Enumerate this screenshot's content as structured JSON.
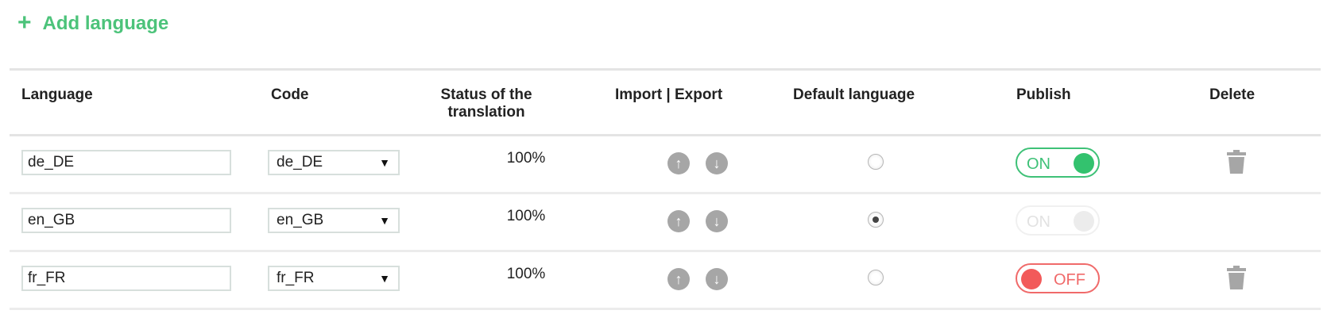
{
  "add_language": {
    "label": "Add language",
    "icon": "plus-icon"
  },
  "columns": {
    "language": "Language",
    "code": "Code",
    "status_line1": "Status of the",
    "status_line2": "translation",
    "import_export": "Import | Export",
    "default_language": "Default language",
    "publish": "Publish",
    "delete": "Delete"
  },
  "rows": [
    {
      "language": "de_DE",
      "code": "de_DE",
      "status": "100%",
      "default": false,
      "publish": {
        "label": "ON",
        "state": "on"
      },
      "deletable": true
    },
    {
      "language": "en_GB",
      "code": "en_GB",
      "status": "100%",
      "default": true,
      "publish": {
        "label": "ON",
        "state": "disabled"
      },
      "deletable": false
    },
    {
      "language": "fr_FR",
      "code": "fr_FR",
      "status": "100%",
      "default": false,
      "publish": {
        "label": "OFF",
        "state": "off"
      },
      "deletable": true
    }
  ],
  "icons": {
    "import": "upload-icon",
    "export": "download-icon",
    "delete": "trash-icon",
    "select": "caret-down-icon"
  },
  "colors": {
    "accent": "#4cc37a",
    "on": "#33c26e",
    "off": "#f25a5a",
    "icon_gray": "#a6a6a6"
  }
}
